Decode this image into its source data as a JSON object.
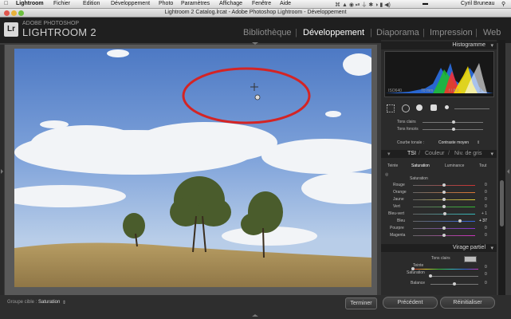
{
  "menubar": {
    "items": [
      "Lightroom",
      "Fichier",
      "Edition",
      "Développement",
      "Photo",
      "Paramètres",
      "Affichage",
      "Fenêtre",
      "Aide"
    ],
    "user": "Cyril Bruneau"
  },
  "window": {
    "title": "Lightroom 2 Catalog.lrcat - Adobe Photoshop Lightroom - Développement"
  },
  "header": {
    "logo": "Lr",
    "brand_small": "ADOBE PHOTOSHOP",
    "brand_large": "LIGHTROOM 2",
    "modules": [
      "Bibliothèque",
      "Développement",
      "Diaporama",
      "Impression",
      "Web"
    ],
    "active_module": "Développement"
  },
  "histogram": {
    "title": "Histogramme",
    "iso": "ISO640",
    "focal": "70 mm",
    "aperture": "f / 8,0",
    "shutter": "1/",
    "channel_colors": [
      "#2e7bff",
      "#1fbf2c",
      "#ff2b2b",
      "#ffe600",
      "#ffffff"
    ]
  },
  "tone": {
    "row1": "Tons clairs",
    "row2": "Tons foncés"
  },
  "curve": {
    "label": "Courbe tonale :",
    "value": "Contraste moyen"
  },
  "hsl": {
    "title_items": [
      "TSI",
      "Couleur",
      "Niv. de gris"
    ],
    "tabs": [
      "Teinte",
      "Saturation",
      "Luminance",
      "Tout"
    ],
    "active_tab": "Saturation",
    "section": "Saturation",
    "rows": [
      {
        "label": "Rouge",
        "value": "0"
      },
      {
        "label": "Orange",
        "value": "0"
      },
      {
        "label": "Jaune",
        "value": "0"
      },
      {
        "label": "Vert",
        "value": "0"
      },
      {
        "label": "Bleu-vert",
        "value": "+ 1"
      },
      {
        "label": "Bleu",
        "value": "+ 37"
      },
      {
        "label": "Pourpre",
        "value": "0"
      },
      {
        "label": "Magenta",
        "value": "0"
      }
    ]
  },
  "split": {
    "title": "Virage partiel",
    "highlights": "Tons clairs",
    "rows": [
      {
        "label": "Teinte",
        "value": "0"
      },
      {
        "label": "Saturation",
        "value": "0"
      },
      {
        "label": "Balance",
        "value": "0"
      }
    ]
  },
  "bottom": {
    "group_label": "Groupe cible :",
    "group_value": "Saturation",
    "finish": "Terminer",
    "previous": "Précédent",
    "reset": "Réinitialiser"
  }
}
